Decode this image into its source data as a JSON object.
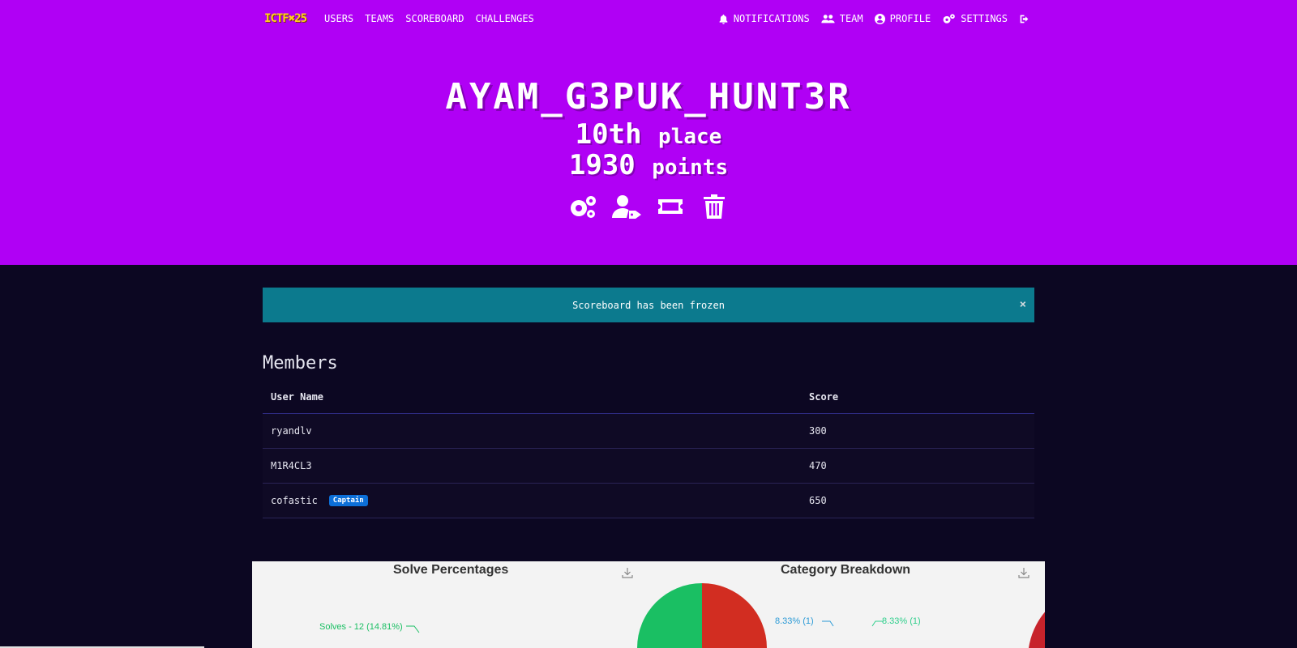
{
  "navbar": {
    "logo_text": "ICTF✖25",
    "links": [
      "USERS",
      "TEAMS",
      "SCOREBOARD",
      "CHALLENGES"
    ],
    "right": [
      {
        "label": "NOTIFICATIONS",
        "icon": "bell-icon"
      },
      {
        "label": "TEAM",
        "icon": "users-icon"
      },
      {
        "label": "PROFILE",
        "icon": "user-circle-icon"
      },
      {
        "label": "SETTINGS",
        "icon": "gears-icon"
      }
    ],
    "logout_icon": "sign-out-icon"
  },
  "team": {
    "name": "AYAM_G3PUK_HUNT3R",
    "place_number": "10th",
    "place_word": "place",
    "points_number": "1930",
    "points_word": "points",
    "action_icons": [
      "gears-icon",
      "user-tag-icon",
      "ticket-icon",
      "trash-icon"
    ]
  },
  "alert": {
    "message": "Scoreboard has been frozen",
    "close": "×"
  },
  "members": {
    "title": "Members",
    "headers": [
      "User Name",
      "Score"
    ],
    "rows": [
      {
        "name": "ryandlv",
        "score": "300",
        "badge": ""
      },
      {
        "name": "M1R4CL3",
        "score": "470",
        "badge": ""
      },
      {
        "name": "cofastic",
        "score": "650",
        "badge": "Captain"
      }
    ]
  },
  "charts": {
    "solve_title": "Solve Percentages",
    "category_title": "Category Breakdown",
    "solve_annotation": "Solves - 12 (14.81%)",
    "category_annotation_left": "8.33% (1)",
    "category_annotation_right": "8.33% (1)"
  },
  "colors": {
    "brand_purple": "#b000f5",
    "background": "#0c0722",
    "alert_teal": "#0c7a8e",
    "captain_badge": "#0c6fd8"
  }
}
